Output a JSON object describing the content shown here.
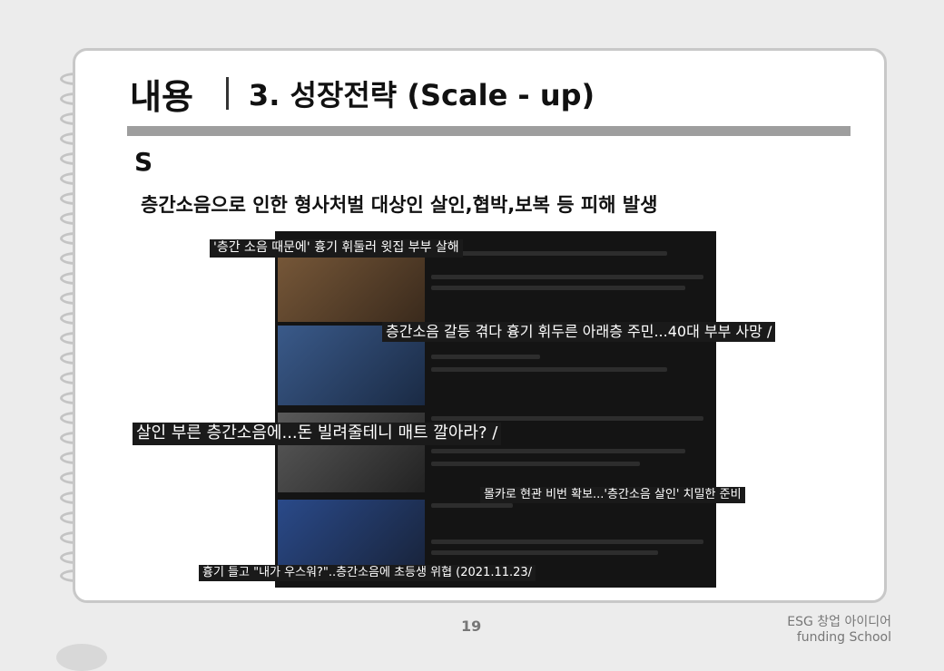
{
  "slide": {
    "title_main": "내용",
    "title_sub": "3. 성장전략 (Scale - up)",
    "section_letter": "S",
    "headline": "층간소음으로 인한 형사처벌 대상인 살인,협박,보복 등 피해 발생",
    "captions": [
      "'층간 소음 때문에' 흉기 휘둘러 윗집 부부 살해",
      "층간소음 갈등 겪다 흉기 휘두른 아래층 주민...40대 부부 사망 /",
      "살인 부른 층간소음에...돈 빌려줄테니 매트 깔아라? /",
      "몰카로 현관 비번 확보...'층간소음 살인' 치밀한 준비",
      "흉기 들고 \"내가 우스워?\"..층간소음에 초등생 위협 (2021.11.23/"
    ],
    "page_number": "19",
    "footer_line1": "ESG 창업 아이디어",
    "footer_line2": "funding School"
  }
}
